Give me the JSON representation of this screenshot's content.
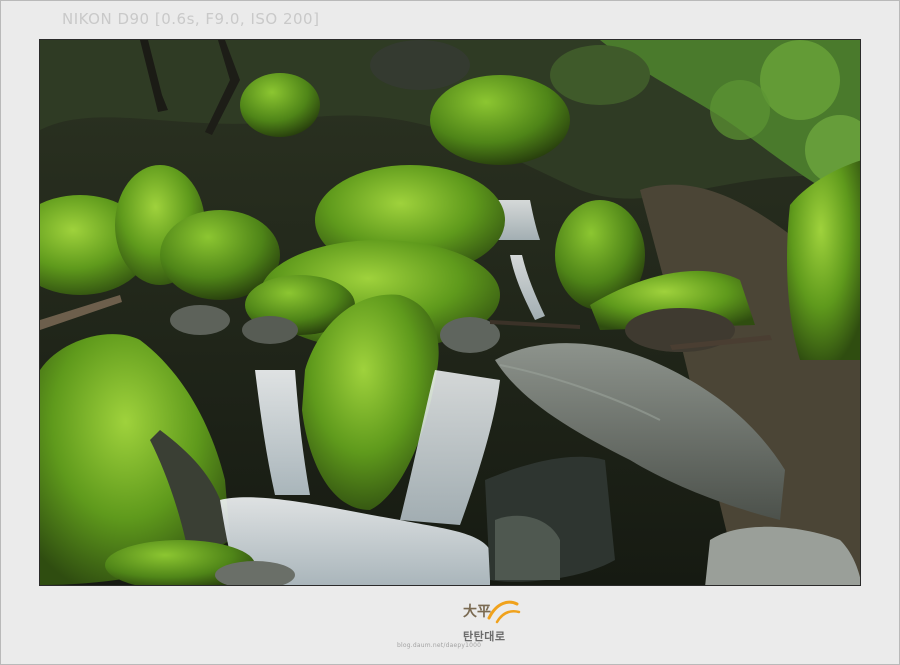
{
  "exif": {
    "camera": "NIKON D90",
    "settings": "[0.6s, F9.0, ISO 200]"
  },
  "photo": {
    "subject": "mossy waterfall",
    "colors": {
      "moss": "#5f9a1c",
      "moss_bright": "#7dbb2a",
      "rock": "#6f7670",
      "water": "#e8eef2",
      "shadow": "#171b14"
    }
  },
  "watermark": {
    "mark": "大平",
    "title": "탄탄대로",
    "url": "blog.daum.net/daepy1000",
    "accent": "#f0a21c"
  }
}
